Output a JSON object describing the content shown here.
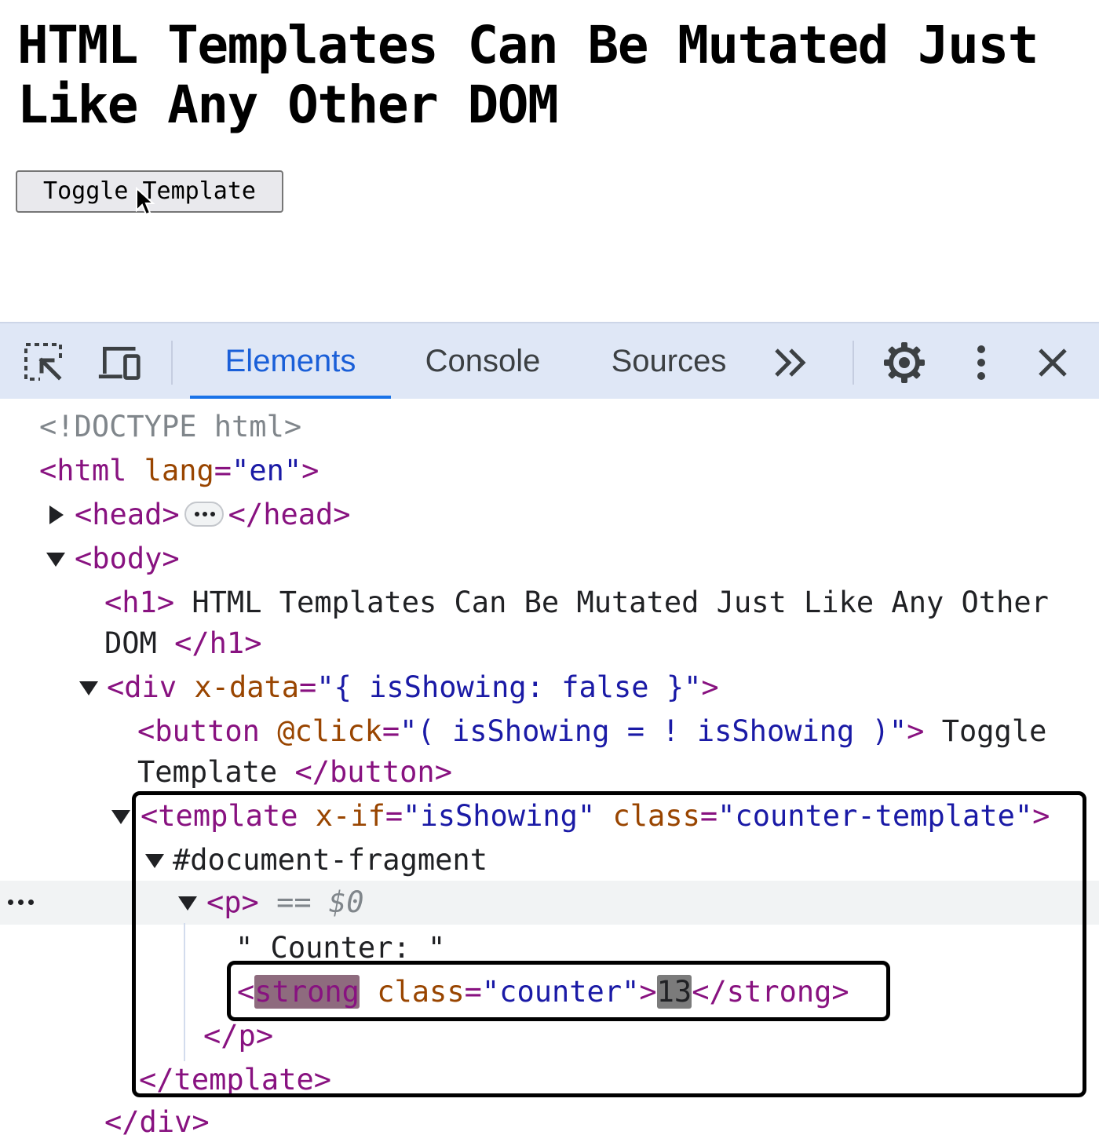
{
  "page": {
    "title": "HTML Templates Can Be Mutated Just Like Any Other DOM",
    "toggle_button_label": "Toggle Template"
  },
  "devtools": {
    "toolbar": {
      "icons": [
        "inspect-element-icon",
        "device-toggle-icon",
        "more-tabs-icon",
        "settings-gear-icon",
        "kebab-menu-icon",
        "close-icon"
      ],
      "tabs": [
        {
          "label": "Elements",
          "active": true
        },
        {
          "label": "Console",
          "active": false
        },
        {
          "label": "Sources",
          "active": false
        }
      ],
      "more_tabs_label": "»"
    },
    "tree": {
      "doctype": "<!DOCTYPE html>",
      "html_open_tag": "<html",
      "html_lang_attr": "lang",
      "html_lang_val": "\"en\"",
      "html_close_bracket": ">",
      "head_open": "<head>",
      "head_close": "</head>",
      "body_open": "<body>",
      "h1_open": "<h1>",
      "h1_text_line1": " HTML Templates Can Be Mutated Just Like Any Other",
      "h1_text_line2": "DOM ",
      "h1_close": "</h1>",
      "div_open_tag": "<div",
      "div_attr": "x-data",
      "div_val": "\"{ isShowing: false }\"",
      "div_close_bracket": ">",
      "button_open_tag": "<button",
      "button_attr": "@click",
      "button_val": "\"( isShowing = ! isShowing )\"",
      "button_close_bracket": ">",
      "button_text_line1": " Toggle",
      "button_text_line2": "Template ",
      "button_close": "</button>",
      "template_open_tag": "<template",
      "template_attr1": "x-if",
      "template_val1": "\"isShowing\"",
      "template_attr2": "class",
      "template_val2": "\"counter-template\"",
      "template_close_bracket": ">",
      "document_fragment": "#document-fragment",
      "p_open": "<p>",
      "selected_marker": "== $0",
      "counter_text": "\" Counter: \"",
      "strong_lt": "<",
      "strong_name": "strong",
      "strong_attr": "class",
      "strong_val": "\"counter\"",
      "strong_gt": ">",
      "strong_value": "13",
      "strong_close": "</strong>",
      "p_close": "</p>",
      "template_close": "</template>",
      "div_close": "</div>"
    }
  }
}
